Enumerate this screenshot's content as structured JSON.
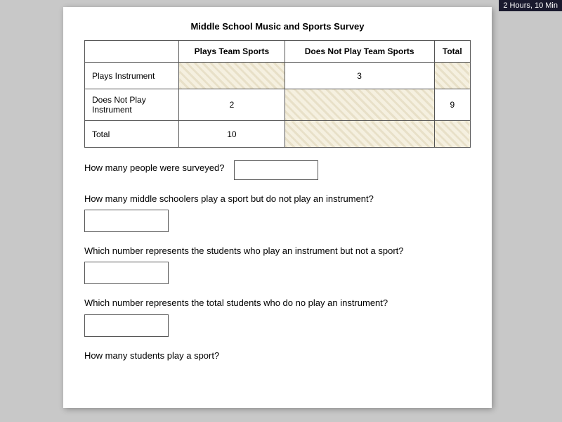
{
  "topbar": {
    "timer": "2 Hours, 10 Min"
  },
  "survey": {
    "title": "Middle School Music and Sports Survey",
    "headers": {
      "row_label": "",
      "col1": "Plays Team Sports",
      "col2": "Does Not Play Team Sports",
      "col3": "Total"
    },
    "rows": [
      {
        "label": "Plays Instrument",
        "col1_value": "",
        "col1_type": "input",
        "col2_value": "3",
        "col2_type": "plain",
        "col3_value": "",
        "col3_type": "input"
      },
      {
        "label": "Does Not Play Instrument",
        "col1_value": "2",
        "col1_type": "plain",
        "col2_value": "",
        "col2_type": "input",
        "col3_value": "9",
        "col3_type": "plain"
      },
      {
        "label": "Total",
        "col1_value": "10",
        "col1_type": "plain",
        "col2_value": "",
        "col2_type": "input",
        "col3_value": "",
        "col3_type": "input"
      }
    ]
  },
  "questions": [
    {
      "id": "q1",
      "text": "How many people were surveyed?",
      "inline": true,
      "answer": ""
    },
    {
      "id": "q2",
      "text": "How many middle schoolers play a sport but do not play an instrument?",
      "inline": false,
      "answer": ""
    },
    {
      "id": "q3",
      "text": "Which number represents the students who play an instrument but not a sport?",
      "inline": false,
      "answer": ""
    },
    {
      "id": "q4",
      "text": "Which number represents the total students who do no play an instrument?",
      "inline": false,
      "answer": ""
    },
    {
      "id": "q5",
      "text": "How many students play a sport?",
      "inline": false,
      "answer": ""
    }
  ]
}
